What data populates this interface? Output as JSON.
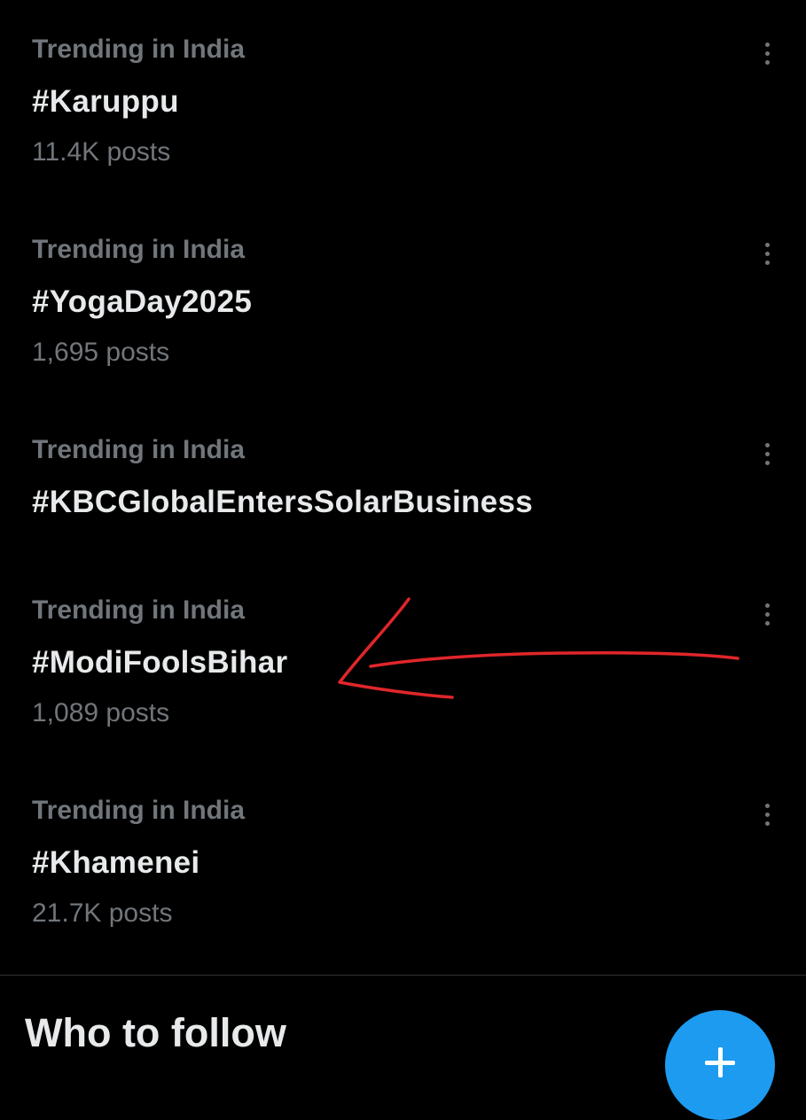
{
  "trends": [
    {
      "context": "Trending in India",
      "title": "#Karuppu",
      "count": "11.4K posts"
    },
    {
      "context": "Trending in India",
      "title": "#YogaDay2025",
      "count": "1,695 posts"
    },
    {
      "context": "Trending in India",
      "title": "#KBCGlobalEntersSolarBusiness",
      "count": ""
    },
    {
      "context": "Trending in India",
      "title": "#ModiFoolsBihar",
      "count": "1,089 posts"
    },
    {
      "context": "Trending in India",
      "title": "#Khamenei",
      "count": "21.7K posts"
    }
  ],
  "who_to_follow": {
    "heading": "Who to follow"
  },
  "icons": {
    "more": "more-options-icon",
    "compose": "plus-icon",
    "annotation": "red-arrow-annotation"
  },
  "colors": {
    "background": "#000000",
    "primary_text": "#e7e9ea",
    "secondary_text": "#71767b",
    "accent": "#1d9bf0",
    "annotation": "#e0262a"
  }
}
